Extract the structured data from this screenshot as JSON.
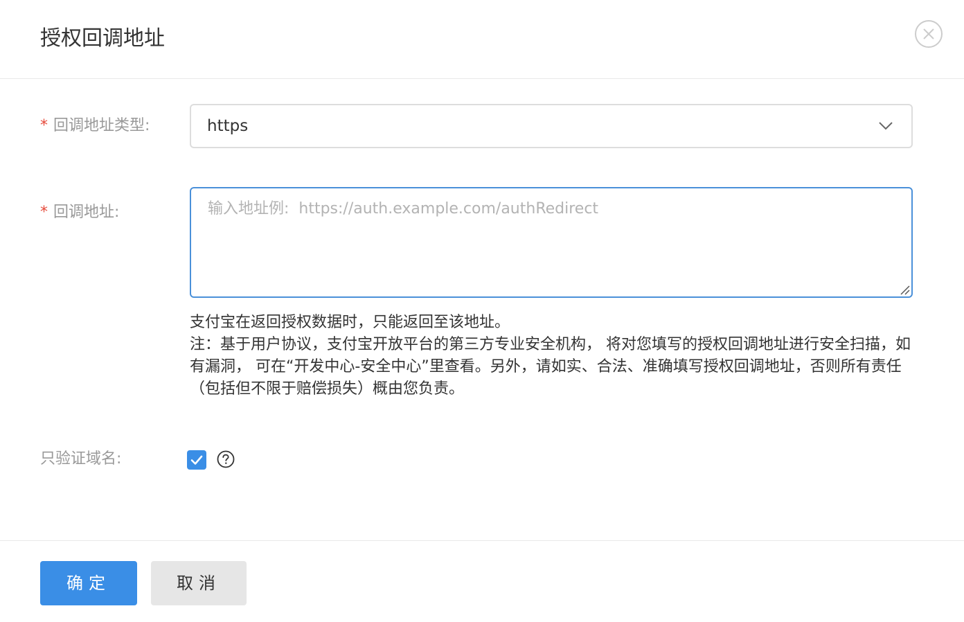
{
  "dialog": {
    "title": "授权回调地址"
  },
  "form": {
    "callback_type": {
      "required_mark": "*",
      "label": "回调地址类型:",
      "selected_value": "https"
    },
    "callback_url": {
      "required_mark": "*",
      "label": "回调地址:",
      "value": "",
      "placeholder": "输入地址例:  https://auth.example.com/authRedirect"
    },
    "help": {
      "line1": "支付宝在返回授权数据时，只能返回至该地址。",
      "line2": "注：基于用户协议，支付宝开放平台的第三方专业安全机构， 将对您填写的授权回调地址进行安全扫描，如有漏洞， 可在“开发中心-安全中心”里查看。另外，请如实、合法、准确填写授权回调地址，否则所有责任（包括但不限于赔偿损失）概由您负责。"
    },
    "domain_only": {
      "label": "只验证域名:",
      "checked": true
    }
  },
  "footer": {
    "confirm_label": "确定",
    "cancel_label": "取消"
  },
  "icons": {
    "close": "close-circle-icon",
    "dropdown": "chevron-down-icon",
    "resize": "resize-grip-icon",
    "check": "checkmark-icon",
    "help": "question-circle-icon"
  },
  "colors": {
    "primary": "#3a8ee6",
    "required": "#e64a3b",
    "focus_border": "#4a90d9"
  }
}
